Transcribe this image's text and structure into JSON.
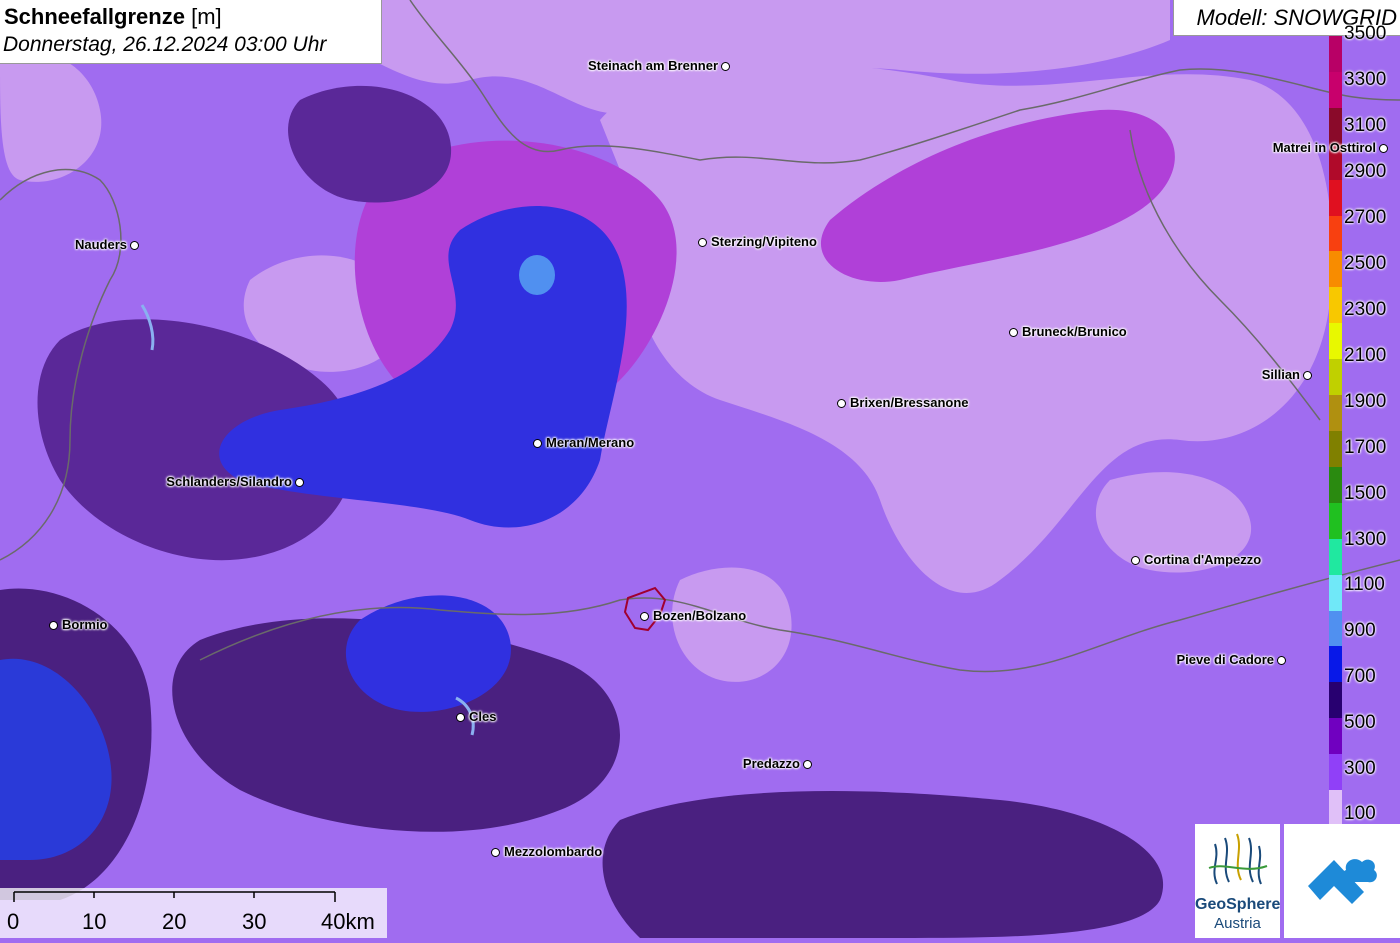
{
  "header": {
    "title_bold": "Schneefallgrenze",
    "title_unit": "[m]",
    "datetime": "Donnerstag, 26.12.2024 03:00 Uhr"
  },
  "model": {
    "label": "Modell: SNOWGRID"
  },
  "legend": {
    "labels": [
      "3500",
      "3300",
      "3100",
      "2900",
      "2700",
      "2500",
      "2300",
      "2100",
      "1900",
      "1700",
      "1500",
      "1300",
      "1100",
      "900",
      "700",
      "500",
      "300",
      "100"
    ],
    "colors": [
      "#b80066",
      "#c8006c",
      "#8a0a2a",
      "#b00a2a",
      "#e01020",
      "#f84010",
      "#f88c00",
      "#f8c800",
      "#e8f800",
      "#c0d000",
      "#b09010",
      "#808000",
      "#2a8a10",
      "#20c020",
      "#20e8a0",
      "#70e8f8",
      "#5090f0",
      "#0818e8",
      "#280070",
      "#7000c0",
      "#9040f8",
      "#e0c0f8"
    ]
  },
  "colors": {
    "background": "#a06cf0",
    "light_lilac": "#c89af0",
    "magenta": "#b040d8",
    "dark_violet": "#5a2898",
    "deep_violet": "#4a2080",
    "blue": "#3030e0",
    "light_blue": "#5090f0",
    "border_line": "#6a6a6a"
  },
  "cities": [
    {
      "name": "Steinach am Brenner",
      "side": "left"
    },
    {
      "name": "Nauders",
      "side": "left"
    },
    {
      "name": "Sterzing/Vipiteno",
      "side": "right"
    },
    {
      "name": "Matrei in Osttirol",
      "side": "left"
    },
    {
      "name": "Bruneck/Brunico",
      "side": "right"
    },
    {
      "name": "Sillian",
      "side": "left"
    },
    {
      "name": "Brixen/Bressanone",
      "side": "right"
    },
    {
      "name": "Meran/Merano",
      "side": "right"
    },
    {
      "name": "Schlanders/Silandro",
      "side": "left"
    },
    {
      "name": "Cortina d'Ampezzo",
      "side": "right"
    },
    {
      "name": "Bormio",
      "side": "right"
    },
    {
      "name": "Bozen/Bolzano",
      "side": "right"
    },
    {
      "name": "Pieve di Cadore",
      "side": "left"
    },
    {
      "name": "Cles",
      "side": "right"
    },
    {
      "name": "Predazzo",
      "side": "left"
    },
    {
      "name": "Mezzolombardo",
      "side": "right"
    }
  ],
  "scale_bar": {
    "labels": [
      "0",
      "10",
      "20",
      "30",
      "40km"
    ]
  },
  "logos": {
    "geosphere_name": "GeoSphere",
    "geosphere_sub": "Austria"
  }
}
